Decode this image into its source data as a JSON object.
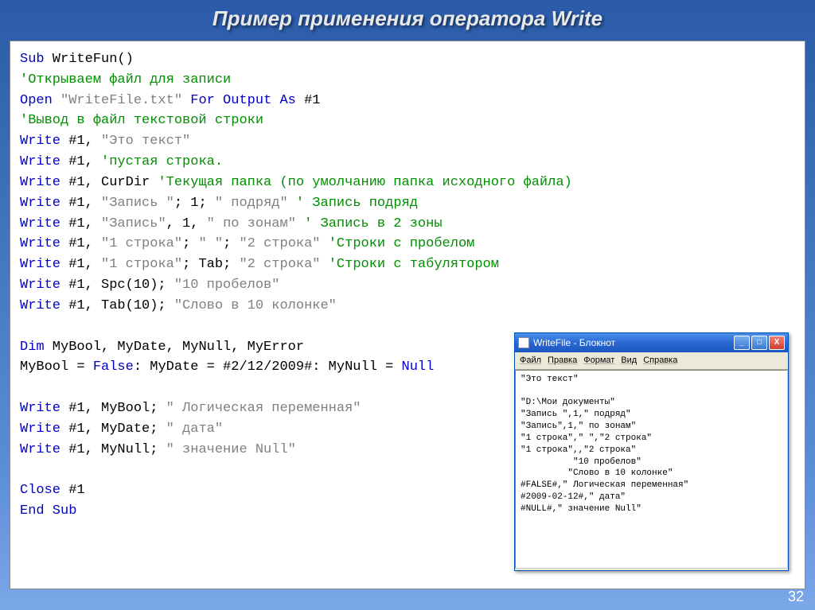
{
  "slide": {
    "title": "Пример применения оператора Write",
    "page_number": "32"
  },
  "code": {
    "l1_kw1": "Sub",
    "l1_nm": " WriteFun()",
    "l2_cm": "'Открываем файл для записи",
    "l3_kw1": "Open",
    "l3_s1": " \"WriteFile.txt\" ",
    "l3_kw2": "For Output As",
    "l3_s2": " #1",
    "l4_cm": "'Вывод в файл текстовой строки",
    "l5_kw": "Write",
    "l5_a": " #1, ",
    "l5_s": "\"Это текст\"",
    "l6_kw": "Write",
    "l6_a": " #1,     ",
    "l6_cm": "'пустая строка.",
    "l7_kw": "Write",
    "l7_a": " #1, CurDir ",
    "l7_cm": "'Текущая папка (по умолчанию папка исходного файла)",
    "l8_kw": "Write",
    "l8_a": " #1, ",
    "l8_s1": "\"Запись \"",
    "l8_b": "; 1; ",
    "l8_s2": "\" подряд\"",
    "l8_sp": "      ",
    "l8_cm": "' Запись подряд",
    "l9_kw": "Write",
    "l9_a": " #1, ",
    "l9_s1": "\"Запись\"",
    "l9_b": ", 1, ",
    "l9_s2": "\" по зонам\"",
    "l9_sp": "     ",
    "l9_cm": "' Запись в 2 зоны",
    "l10_kw": "Write",
    "l10_a": " #1, ",
    "l10_s1": "\"1 строка\"",
    "l10_b1": "; ",
    "l10_s2": "\" \"",
    "l10_b2": "; ",
    "l10_s3": "\"2 строка\"",
    "l10_sp": "      ",
    "l10_cm": "'Строки с пробелом",
    "l11_kw": "Write",
    "l11_a": " #1, ",
    "l11_s1": "\"1 строка\"",
    "l11_b1": "; Tab; ",
    "l11_s3": "\"2 строка\"",
    "l11_sp": "      ",
    "l11_cm": "'Строки с табулятором",
    "l12_kw": "Write",
    "l12_a": " #1, Spc(10); ",
    "l12_s": "\"10 пробелов\"",
    "l13_kw": "Write",
    "l13_a": " #1, Tab(10); ",
    "l13_s": "\"Слово в 10 колонке\"",
    "l15_kw": "Dim",
    "l15_a": " MyBool, MyDate, MyNull, MyError",
    "l16_a": "MyBool = ",
    "l16_kw1": "False",
    "l16_b": ": MyDate = #2/12/2009#: MyNull = ",
    "l16_kw2": "Null",
    "l18_kw": "Write",
    "l18_a": " #1, MyBool; ",
    "l18_s": "\" Логическая переменная\"",
    "l19_kw": "Write",
    "l19_a": " #1, MyDate; ",
    "l19_s": "\" дата\"",
    "l20_kw": "Write",
    "l20_a": " #1, MyNull; ",
    "l20_s": "\" значение Null\"",
    "l22_kw": "Close",
    "l22_a": " #1",
    "l23_kw": "End Sub"
  },
  "notepad": {
    "title": "WriteFile - Блокнот",
    "menu": {
      "file": "Файл",
      "edit": "Правка",
      "format": "Формат",
      "view": "Вид",
      "help": "Справка"
    },
    "content": "\"Это текст\"\n\n\"D:\\Мои документы\"\n\"Запись \",1,\" подряд\"\n\"Запись\",1,\" по зонам\"\n\"1 строка\",\" \",\"2 строка\"\n\"1 строка\",,\"2 строка\"\n          \"10 пробелов\"\n         \"Слово в 10 колонке\"\n#FALSE#,\" Логическая переменная\"\n#2009-02-12#,\" дата\"\n#NULL#,\" значение Null\""
  }
}
